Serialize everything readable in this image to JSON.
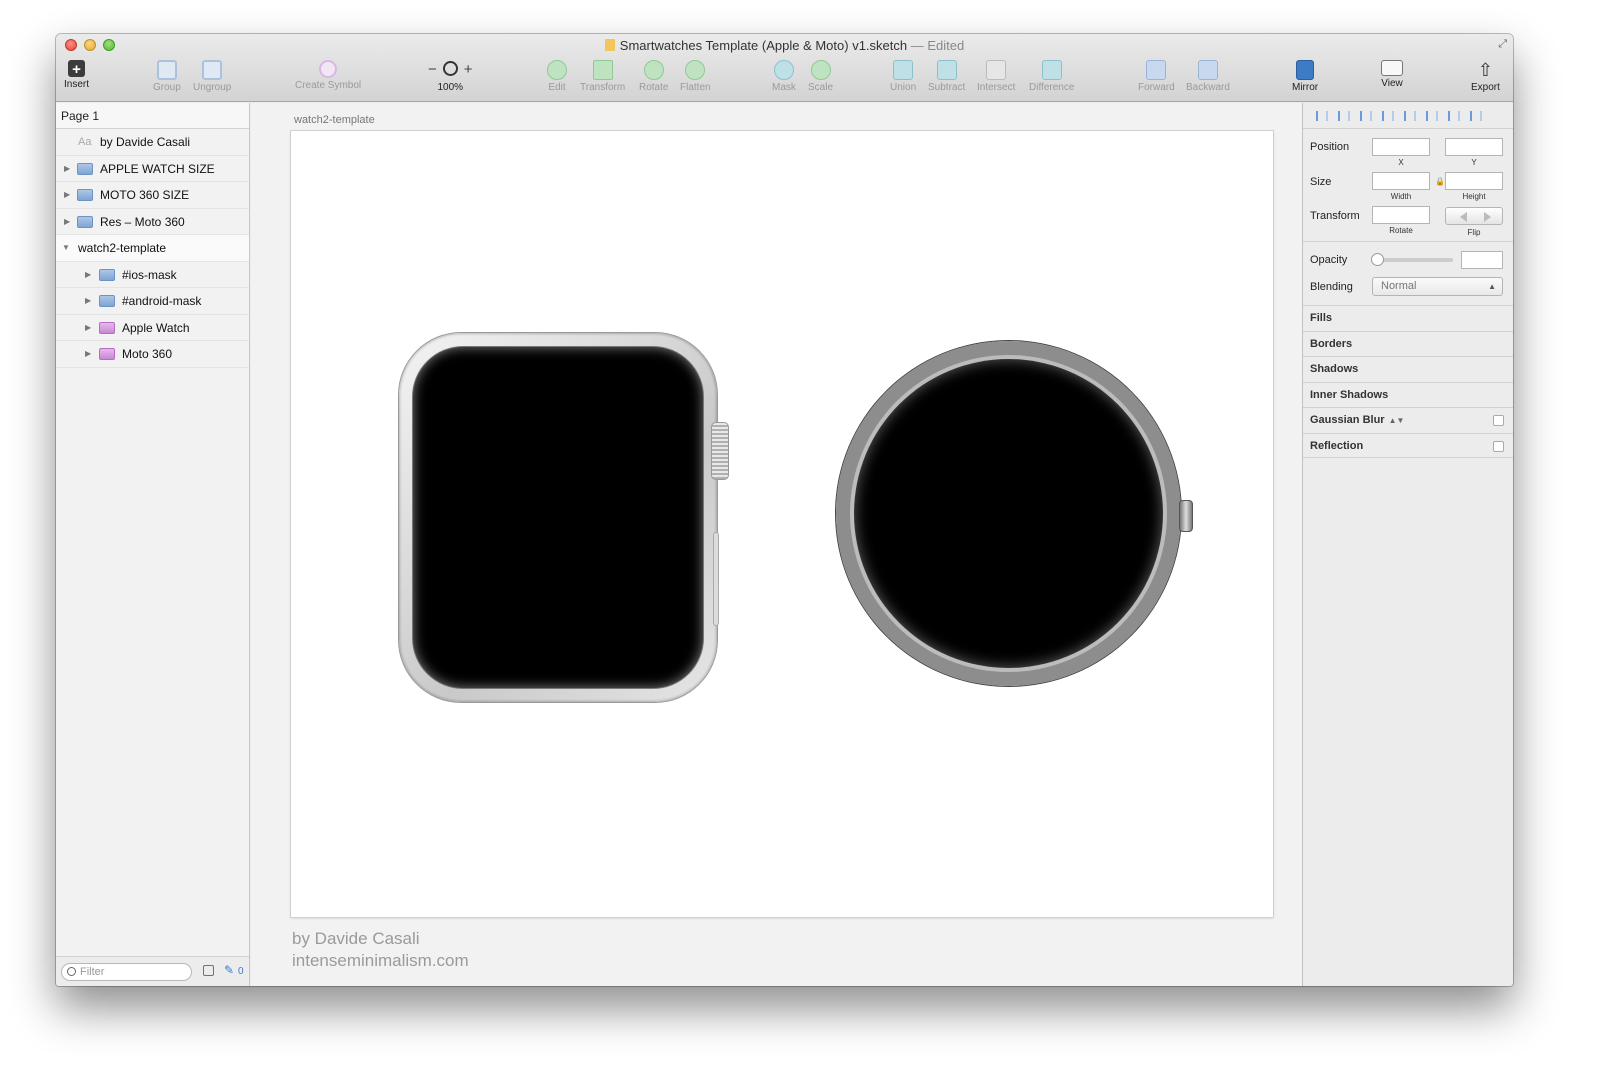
{
  "window": {
    "title": "Smartwatches Template (Apple & Moto) v1.sketch",
    "status": "— Edited"
  },
  "toolbar": {
    "insert": "Insert",
    "group": "Group",
    "ungroup": "Ungroup",
    "create_symbol": "Create Symbol",
    "zoom_minus": "−",
    "zoom_plus": "+",
    "zoom_level": "100%",
    "edit": "Edit",
    "transform": "Transform",
    "rotate": "Rotate",
    "flatten": "Flatten",
    "mask": "Mask",
    "scale": "Scale",
    "union": "Union",
    "subtract": "Subtract",
    "intersect": "Intersect",
    "difference": "Difference",
    "forward": "Forward",
    "backward": "Backward",
    "mirror": "Mirror",
    "view": "View",
    "export": "Export"
  },
  "sidebar": {
    "page": "Page 1",
    "layers": [
      {
        "label": "by Davide Casali",
        "type": "text"
      },
      {
        "label": "APPLE WATCH SIZE",
        "type": "folder"
      },
      {
        "label": "MOTO 360 SIZE",
        "type": "folder"
      },
      {
        "label": "Res – Moto 360",
        "type": "folder"
      },
      {
        "label": "watch2-template",
        "type": "artboard"
      },
      {
        "label": "#ios-mask",
        "type": "folder"
      },
      {
        "label": "#android-mask",
        "type": "folder"
      },
      {
        "label": "Apple Watch",
        "type": "symbol"
      },
      {
        "label": "Moto 360",
        "type": "symbol"
      }
    ],
    "text_layer_icon": "Aa",
    "filter_placeholder": "Filter",
    "filter_count": "0"
  },
  "canvas": {
    "artboard_name": "watch2-template",
    "credit_line1": "by Davide Casali",
    "credit_line2": "intenseminimalism.com"
  },
  "inspector": {
    "position_label": "Position",
    "x_label": "X",
    "y_label": "Y",
    "size_label": "Size",
    "width_label": "Width",
    "height_label": "Height",
    "transform_label": "Transform",
    "rotate_label": "Rotate",
    "flip_label": "Flip",
    "opacity_label": "Opacity",
    "blending_label": "Blending",
    "blending_value": "Normal",
    "sections": [
      "Fills",
      "Borders",
      "Shadows",
      "Inner Shadows",
      "Gaussian Blur",
      "Reflection"
    ]
  },
  "colors": {
    "accent": "#3a7bd5",
    "folder_blue": "#7fa4d2",
    "symbol_purple": "#c987d6"
  }
}
